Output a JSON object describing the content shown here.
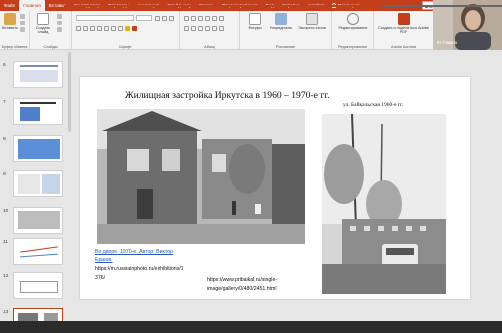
{
  "ribbon_tabs": [
    "Файл",
    "Главная",
    "Вставка",
    "Конструктор",
    "Переходы",
    "Анимация",
    "Слайд-шоу",
    "Запись",
    "Рецензирование",
    "Вид",
    "Справка",
    "Acrobat"
  ],
  "active_tab": "Главная",
  "help_tab": "Помощник",
  "share_label": "Общ",
  "ribbon": {
    "clipboard": {
      "paste": "Вставить",
      "group": "Буфер обмена"
    },
    "slides": {
      "new_slide": "Создать слайд",
      "group": "Слайды"
    },
    "font": {
      "group": "Шрифт"
    },
    "paragraph": {
      "group": "Абзац"
    },
    "drawing": {
      "shapes": "Фигуры",
      "arrange": "Упорядочить",
      "quick_styles": "Экспресс-стили",
      "group": "Рисование"
    },
    "editing": {
      "editing": "Редактирование",
      "group": "Редактирование"
    },
    "acrobat": {
      "create": "Создать и поделиться Adobe PDF",
      "group": "Adobe Acrobat"
    }
  },
  "webcam": {
    "name": "Ю.Гомина"
  },
  "thumbnails": [
    {
      "number": "6"
    },
    {
      "number": "7"
    },
    {
      "number": "8"
    },
    {
      "number": "9"
    },
    {
      "number": "10"
    },
    {
      "number": "11"
    },
    {
      "number": "12"
    },
    {
      "number": "13"
    }
  ],
  "slide": {
    "title": "Жилищная застройка Иркутска в 1960 – 1970-е гг.",
    "photo_caption": "ул. Байкальская 1960-е гг.",
    "link_line1": "Во дворе. 1970-е. Автор: Виктор",
    "link_line2": "Ершов.",
    "url1_line1": "https://m.russiainphoto.ru/exhibitions/1",
    "url1_line2": "376/",
    "url2_line1": "https://www.pribaikal.ru/single-",
    "url2_line2": "image/gallery/0/480/2451.html"
  },
  "progress": {
    "fraction": 0.72
  },
  "colors": {
    "accent": "#c43e1c",
    "link": "#2a5ab8"
  }
}
